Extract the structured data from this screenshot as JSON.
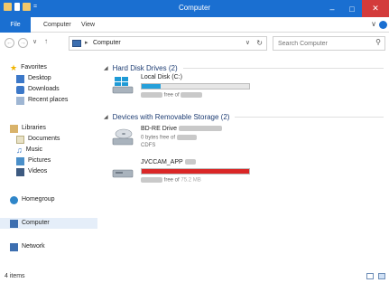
{
  "window": {
    "title": "Computer"
  },
  "ribbon": {
    "tabs": [
      "File",
      "Computer",
      "View"
    ]
  },
  "address": {
    "path": "Computer",
    "search_placeholder": "Search Computer"
  },
  "nav": {
    "favorites": {
      "label": "Favorites",
      "items": [
        "Desktop",
        "Downloads",
        "Recent places"
      ]
    },
    "libraries": {
      "label": "Libraries",
      "items": [
        "Documents",
        "Music",
        "Pictures",
        "Videos"
      ]
    },
    "homegroup": "Homegroup",
    "computer": "Computer",
    "network": "Network"
  },
  "content": {
    "hdd_section": "Hard Disk Drives (2)",
    "removable_section": "Devices with Removable Storage (2)",
    "drives": [
      {
        "name": "Local Disk (C:)",
        "free_suffix": "free of",
        "used_fraction": 0.18,
        "bar_color": "#26a0da"
      },
      {
        "name": "BD-RE Drive",
        "line2_prefix": "0 bytes free of",
        "line3": "CDFS"
      },
      {
        "name": "JVCCAM_APP",
        "free_suffix": "free of",
        "free_total": "75.2 MB",
        "used_fraction": 1.0,
        "bar_color": "#da2626"
      }
    ]
  },
  "status": {
    "items": "4 items"
  },
  "colors": {
    "titlebar": "#1a6fd1",
    "accent": "#1a6fd1",
    "close": "#d33b3b"
  }
}
